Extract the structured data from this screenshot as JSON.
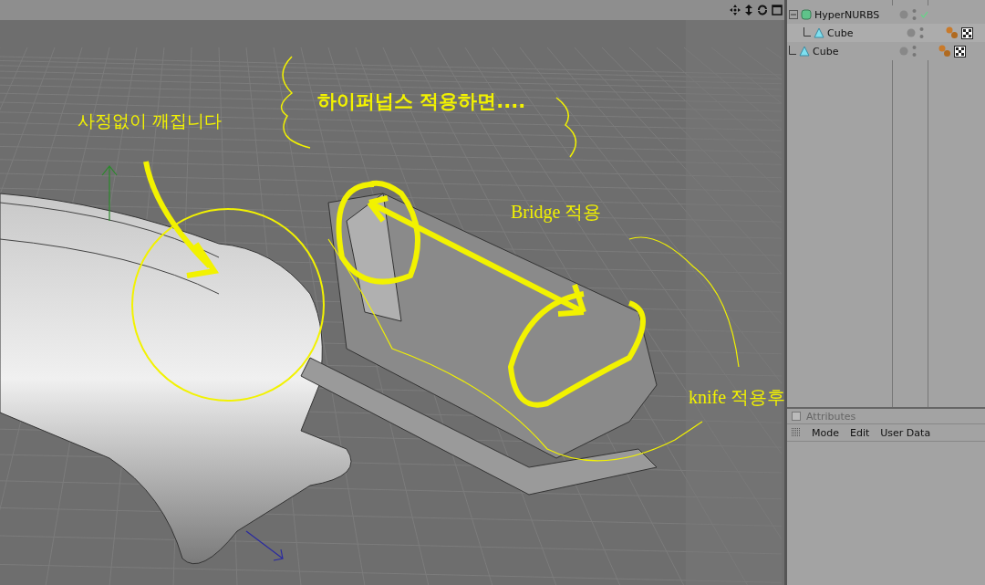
{
  "viewport": {
    "annotations": [
      {
        "text": "사정없이 깨집니다",
        "kind": "sans"
      },
      {
        "text": "하이퍼넙스 적용하면....",
        "kind": "bold"
      },
      {
        "text": "Bridge 적용",
        "kind": "serif"
      },
      {
        "text": "knife 적용후",
        "kind": "serif"
      }
    ]
  },
  "objects": [
    {
      "name": "HyperNURBS",
      "kind": "nurbs",
      "enabled": true,
      "tagged": false,
      "children": [
        {
          "name": "Cube",
          "kind": "cube",
          "enabled": false,
          "tagged": true
        }
      ]
    },
    {
      "name": "Cube",
      "kind": "cube",
      "enabled": false,
      "tagged": true
    }
  ],
  "attributes": {
    "title": "Attributes",
    "menu": [
      "Mode",
      "Edit",
      "User Data"
    ]
  }
}
